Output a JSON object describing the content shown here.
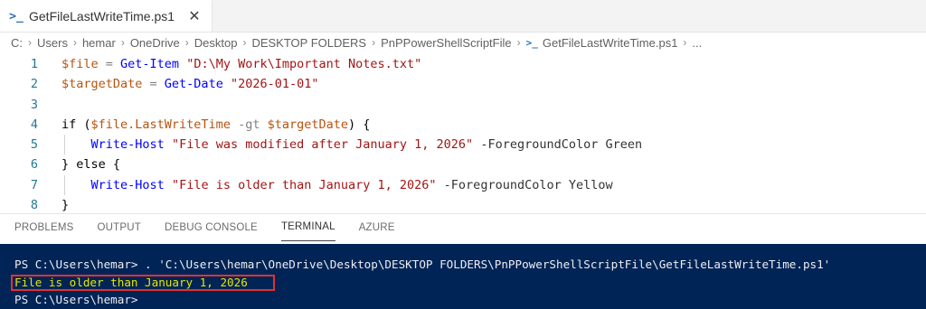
{
  "tab": {
    "icon": "powershell-icon",
    "label": "GetFileLastWriteTime.ps1",
    "close": "✕"
  },
  "breadcrumb": {
    "parts": [
      "C:",
      "Users",
      "hemar",
      "OneDrive",
      "Desktop",
      "DESKTOP FOLDERS",
      "PnPPowerShellScriptFile",
      "GetFileLastWriteTime.ps1",
      "..."
    ],
    "separator": "›"
  },
  "editor": {
    "line_numbers": [
      "1",
      "2",
      "3",
      "4",
      "5",
      "6",
      "7",
      "8"
    ],
    "lines": [
      [
        {
          "t": "$file",
          "c": "var"
        },
        {
          "t": " = ",
          "c": "op"
        },
        {
          "t": "Get-Item",
          "c": "cmd"
        },
        {
          "t": " ",
          "c": "op"
        },
        {
          "t": "\"D:\\My Work\\Important Notes.txt\"",
          "c": "str"
        }
      ],
      [
        {
          "t": "$targetDate",
          "c": "var"
        },
        {
          "t": " = ",
          "c": "op"
        },
        {
          "t": "Get-Date",
          "c": "cmd"
        },
        {
          "t": " ",
          "c": "op"
        },
        {
          "t": "\"2026-01-01\"",
          "c": "str"
        }
      ],
      [],
      [
        {
          "t": "if (",
          "c": "kw"
        },
        {
          "t": "$file.LastWriteTime",
          "c": "var"
        },
        {
          "t": " -gt ",
          "c": "op"
        },
        {
          "t": "$targetDate",
          "c": "var"
        },
        {
          "t": ") {",
          "c": "kw"
        }
      ],
      [
        {
          "t": "    ",
          "c": "kw"
        },
        {
          "t": "Write-Host",
          "c": "cmd"
        },
        {
          "t": " ",
          "c": "kw"
        },
        {
          "t": "\"File was modified after January 1, 2026\"",
          "c": "str"
        },
        {
          "t": " -ForegroundColor Green",
          "c": "prm"
        }
      ],
      [
        {
          "t": "} else {",
          "c": "kw"
        }
      ],
      [
        {
          "t": "    ",
          "c": "kw"
        },
        {
          "t": "Write-Host",
          "c": "cmd"
        },
        {
          "t": " ",
          "c": "kw"
        },
        {
          "t": "\"File is older than January 1, 2026\"",
          "c": "str"
        },
        {
          "t": " -ForegroundColor Yellow",
          "c": "prm"
        }
      ],
      [
        {
          "t": "}",
          "c": "kw"
        }
      ]
    ]
  },
  "panel": {
    "tabs": [
      "PROBLEMS",
      "OUTPUT",
      "DEBUG CONSOLE",
      "TERMINAL",
      "AZURE"
    ],
    "active_tab": "TERMINAL"
  },
  "terminal": {
    "lines": [
      "PS C:\\Users\\hemar> . 'C:\\Users\\hemar\\OneDrive\\Desktop\\DESKTOP FOLDERS\\PnPPowerShellScriptFile\\GetFileLastWriteTime.ps1'",
      "File is older than January 1, 2026",
      "PS C:\\Users\\hemar>"
    ],
    "output_color": "#e6e600",
    "background": "#012456"
  },
  "colors": {
    "highlight_box": "#e03131",
    "accent": "#2b6fb6"
  }
}
